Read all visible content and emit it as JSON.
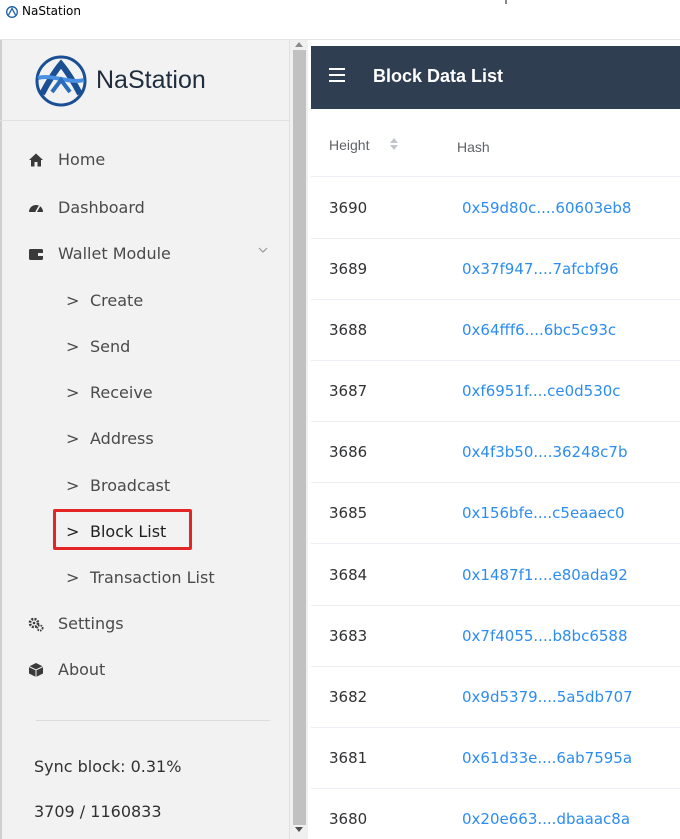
{
  "window": {
    "title": "NaStation"
  },
  "sidebar": {
    "brand": "NaStation",
    "nav": [
      {
        "label": "Home",
        "icon": "home-icon"
      },
      {
        "label": "Dashboard",
        "icon": "dashboard-icon"
      },
      {
        "label": "Wallet Module",
        "icon": "wallet-icon"
      }
    ],
    "wallet_items": [
      {
        "label": "Create"
      },
      {
        "label": "Send"
      },
      {
        "label": "Receive"
      },
      {
        "label": "Address"
      },
      {
        "label": "Broadcast"
      },
      {
        "label": "Block List"
      },
      {
        "label": "Transaction List"
      }
    ],
    "nav_bottom": [
      {
        "label": "Settings",
        "icon": "settings-icon"
      },
      {
        "label": "About",
        "icon": "about-icon"
      }
    ],
    "sync_label": "Sync block: 0.31%",
    "sync_count": "3709 / 1160833"
  },
  "header": {
    "title": "Block Data List"
  },
  "table": {
    "columns": [
      "Height",
      "Hash"
    ],
    "rows": [
      {
        "height": "3690",
        "hash": "0x59d80c....60603eb8"
      },
      {
        "height": "3689",
        "hash": "0x37f947....7afcbf96"
      },
      {
        "height": "3688",
        "hash": "0x64fff6....6bc5c93c"
      },
      {
        "height": "3687",
        "hash": "0xf6951f....ce0d530c"
      },
      {
        "height": "3686",
        "hash": "0x4f3b50....36248c7b"
      },
      {
        "height": "3685",
        "hash": "0x156bfe....c5eaaec0"
      },
      {
        "height": "3684",
        "hash": "0x1487f1....e80ada92"
      },
      {
        "height": "3683",
        "hash": "0x7f4055....b8bc6588"
      },
      {
        "height": "3682",
        "hash": "0x9d5379....5a5db707"
      },
      {
        "height": "3681",
        "hash": "0x61d33e....6ab7595a"
      },
      {
        "height": "3680",
        "hash": "0x20e663....dbaaac8a"
      }
    ]
  },
  "colors": {
    "header_bg": "#2f3e50",
    "link": "#2d8cf0",
    "highlight": "#e42525",
    "sidebar_bg": "#f2f2f2"
  }
}
